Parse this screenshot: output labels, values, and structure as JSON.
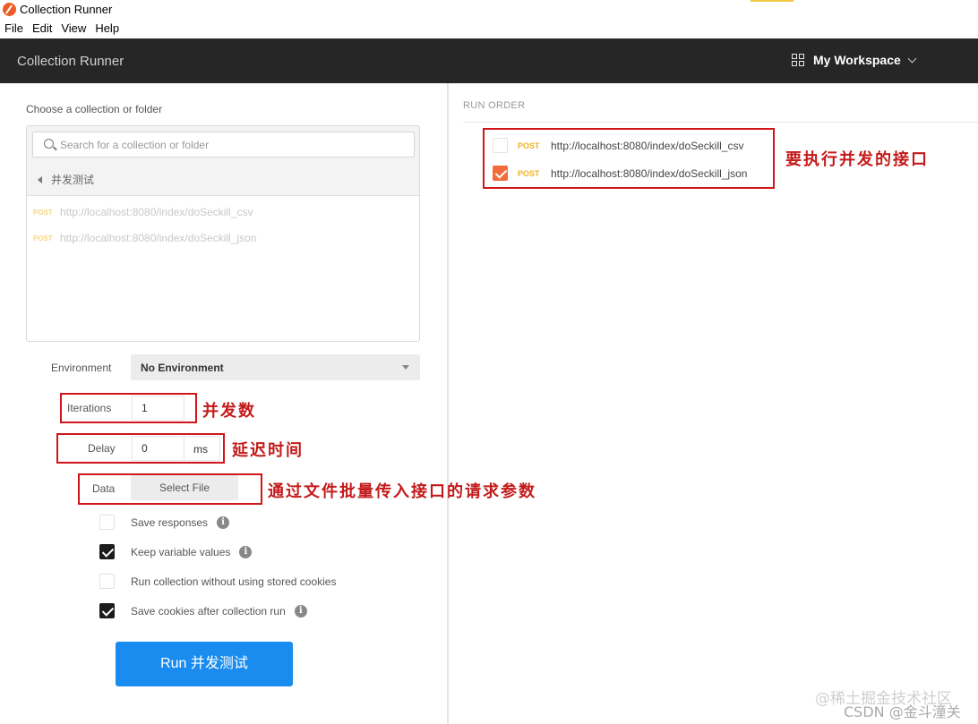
{
  "window": {
    "title": "Collection Runner"
  },
  "menu": {
    "items": [
      "File",
      "Edit",
      "View",
      "Help"
    ]
  },
  "header": {
    "title": "Collection Runner",
    "workspace": "My Workspace"
  },
  "left": {
    "choose_label": "Choose a collection or folder",
    "search_placeholder": "Search for a collection or folder",
    "folder": "并发测试",
    "requests": [
      {
        "method": "POST",
        "url": "http://localhost:8080/index/doSeckill_csv"
      },
      {
        "method": "POST",
        "url": "http://localhost:8080/index/doSeckill_json"
      }
    ],
    "environment": {
      "label": "Environment",
      "value": "No Environment"
    },
    "iterations": {
      "label": "Iterations",
      "value": "1"
    },
    "delay": {
      "label": "Delay",
      "value": "0",
      "unit": "ms"
    },
    "data": {
      "label": "Data",
      "button": "Select File"
    },
    "checkboxes": [
      {
        "label": "Save responses",
        "checked": false,
        "info": true
      },
      {
        "label": "Keep variable values",
        "checked": true,
        "info": true
      },
      {
        "label": "Run collection without using stored cookies",
        "checked": false,
        "info": false
      },
      {
        "label": "Save cookies after collection run",
        "checked": true,
        "info": true
      }
    ],
    "run_button": "Run 并发测试"
  },
  "right": {
    "heading": "RUN ORDER",
    "items": [
      {
        "method": "POST",
        "url": "http://localhost:8080/index/doSeckill_csv",
        "checked": false
      },
      {
        "method": "POST",
        "url": "http://localhost:8080/index/doSeckill_json",
        "checked": true
      }
    ]
  },
  "annotations": {
    "run_order": "要执行并发的接口",
    "iterations": "并发数",
    "delay": "延迟时间",
    "data": "通过文件批量传入接口的请求参数"
  },
  "colors": {
    "accent_orange": "#f26b3a",
    "run_button": "#1a8cf0",
    "annotation_red": "#d0151b",
    "header_bg": "#262626"
  },
  "watermark": {
    "line1": "@稀土掘金技术社区",
    "line2": "CSDN @金斗潼关"
  }
}
